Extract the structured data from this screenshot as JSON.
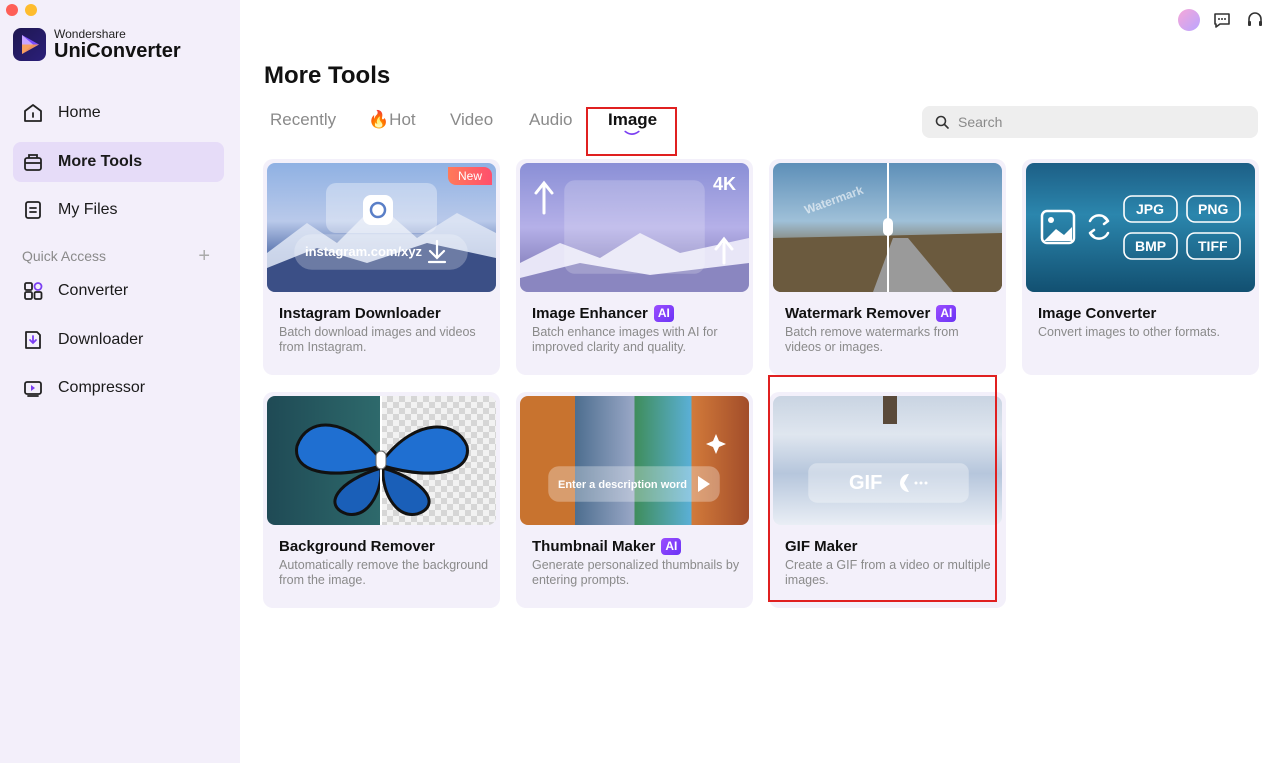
{
  "brand": {
    "company": "Wondershare",
    "product": "UniConverter"
  },
  "nav": {
    "home": "Home",
    "more_tools": "More Tools",
    "my_files": "My Files",
    "quick_access": "Quick Access",
    "converter": "Converter",
    "downloader": "Downloader",
    "compressor": "Compressor"
  },
  "page": {
    "title": "More Tools"
  },
  "tabs": {
    "recently": "Recently",
    "hot": "Hot",
    "hot_icon": "fire-icon",
    "video": "Video",
    "audio": "Audio",
    "image": "Image",
    "active": "Image"
  },
  "search": {
    "placeholder": "Search",
    "value": ""
  },
  "cards": [
    {
      "title": "Instagram Downloader",
      "desc": "Batch download images and videos from Instagram.",
      "badge": "New",
      "ai": false,
      "overlay": "instagram.com/xyz"
    },
    {
      "title": "Image Enhancer",
      "desc": "Batch enhance images with AI for improved clarity and quality.",
      "ai": true,
      "overlay": "4K"
    },
    {
      "title": "Watermark Remover",
      "desc": "Batch remove watermarks from videos or images.",
      "ai": true,
      "overlay": "Watermark"
    },
    {
      "title": "Image Converter",
      "desc": "Convert images to other formats.",
      "ai": false,
      "formats": [
        "JPG",
        "PNG",
        "BMP",
        "TIFF"
      ]
    },
    {
      "title": "Background Remover",
      "desc": "Automatically remove the background from the image.",
      "ai": false
    },
    {
      "title": "Thumbnail Maker",
      "desc": "Generate personalized thumbnails by entering prompts.",
      "ai": true,
      "overlay": "Enter a description word"
    },
    {
      "title": "GIF Maker",
      "desc": "Create a GIF from a video or multiple images.",
      "ai": false,
      "overlay": "GIF"
    }
  ],
  "ai_label": "AI",
  "colors": {
    "accent": "#7b3ff2",
    "highlight": "#e02020",
    "sidebar_bg": "#f3effa",
    "active_nav": "#e6dcf8"
  }
}
